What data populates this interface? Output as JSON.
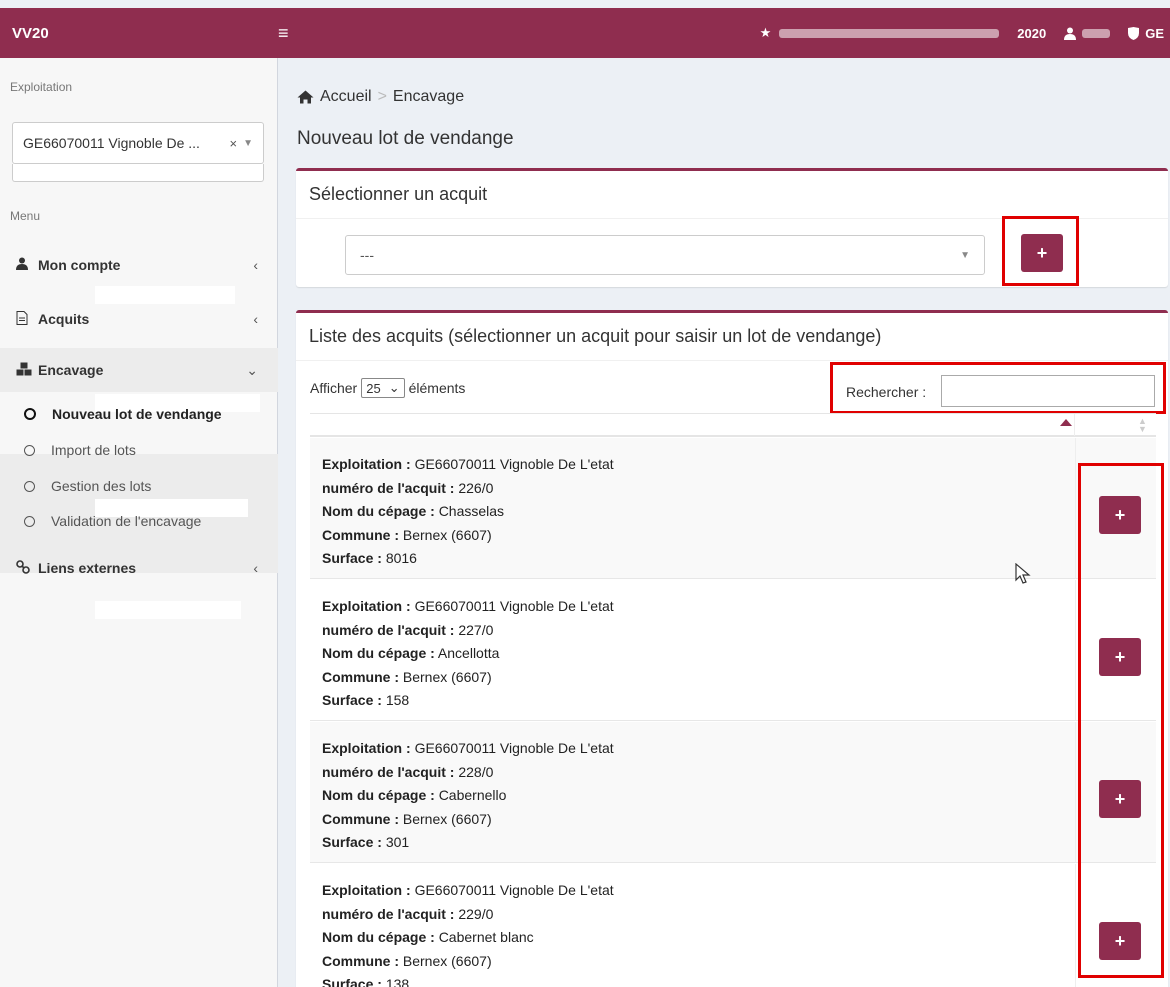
{
  "header": {
    "brand": "VV20",
    "hamburger": "≡",
    "star_icon": "★",
    "year": "2020",
    "user_icon": "user-icon",
    "org": "GE"
  },
  "sidebar": {
    "exploitation_label": "Exploitation",
    "exploitation_value": "GE66070011 Vignoble De ...",
    "clear": "×",
    "menu_label": "Menu",
    "items": [
      {
        "label": "Mon compte",
        "icon": "user-icon"
      },
      {
        "label": "Acquits",
        "icon": "document-icon"
      },
      {
        "label": "Encavage",
        "icon": "cubes-icon"
      },
      {
        "label": "Liens externes",
        "icon": "link-icon"
      }
    ],
    "submenu": [
      {
        "label": "Nouveau lot de vendange"
      },
      {
        "label": "Import de lots"
      },
      {
        "label": "Gestion des lots"
      },
      {
        "label": "Validation de l'encavage"
      }
    ]
  },
  "breadcrumb": {
    "home": "Accueil",
    "current": "Encavage"
  },
  "page_title": "Nouveau lot de vendange",
  "select_box": {
    "title": "Sélectionner un acquit",
    "value": "---",
    "add": "+"
  },
  "list_box": {
    "title": "Liste des acquits (sélectionner un acquit pour saisir un lot de vendange)",
    "show_prefix": "Afficher",
    "page_size": "25",
    "show_suffix": "éléments",
    "search_label": "Rechercher :"
  },
  "labels": {
    "exploitation": "Exploitation :",
    "acquit": "numéro de l'acquit :",
    "cepage": "Nom du cépage :",
    "commune": "Commune :",
    "surface": "Surface :"
  },
  "rows": [
    {
      "exploitation": "GE66070011 Vignoble De L'etat",
      "acquit": "226/0",
      "cepage": "Chasselas",
      "commune": "Bernex (6607)",
      "surface": "8016"
    },
    {
      "exploitation": "GE66070011 Vignoble De L'etat",
      "acquit": "227/0",
      "cepage": "Ancellotta",
      "commune": "Bernex (6607)",
      "surface": "158"
    },
    {
      "exploitation": "GE66070011 Vignoble De L'etat",
      "acquit": "228/0",
      "cepage": "Cabernello",
      "commune": "Bernex (6607)",
      "surface": "301"
    },
    {
      "exploitation": "GE66070011 Vignoble De L'etat",
      "acquit": "229/0",
      "cepage": "Cabernet blanc",
      "commune": "Bernex (6607)",
      "surface": "138"
    }
  ],
  "row_button": "+",
  "colors": {
    "brand": "#8f2d4f",
    "highlight": "#e00000"
  }
}
